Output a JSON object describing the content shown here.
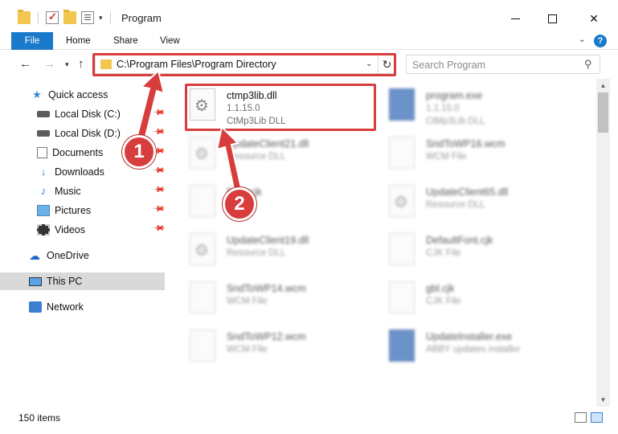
{
  "window": {
    "title": "Program",
    "controls": {
      "minimize": "minimize",
      "maximize": "maximize",
      "close": "✕"
    }
  },
  "ribbon": {
    "tabs": [
      "File",
      "Home",
      "Share",
      "View"
    ],
    "help": "?"
  },
  "address_bar": {
    "path": "C:\\Program Files\\Program Directory",
    "refresh_glyph": "↻"
  },
  "search": {
    "placeholder": "Search Program"
  },
  "sidebar": {
    "items": [
      {
        "label": "Quick access",
        "icon": "star-icon"
      },
      {
        "label": "Local Disk (C:)",
        "icon": "disk-icon",
        "pinned": true
      },
      {
        "label": "Local Disk (D:)",
        "icon": "disk-icon",
        "pinned": true
      },
      {
        "label": "Documents",
        "icon": "documents-icon",
        "pinned": true
      },
      {
        "label": "Downloads",
        "icon": "downloads-icon",
        "pinned": true
      },
      {
        "label": "Music",
        "icon": "music-icon",
        "pinned": true
      },
      {
        "label": "Pictures",
        "icon": "pictures-icon",
        "pinned": true
      },
      {
        "label": "Videos",
        "icon": "videos-icon",
        "pinned": true
      },
      {
        "label": "OneDrive",
        "icon": "onedrive-icon"
      },
      {
        "label": "This PC",
        "icon": "this-pc-icon",
        "selected": true
      },
      {
        "label": "Network",
        "icon": "network-icon"
      }
    ]
  },
  "files": [
    {
      "name": "ctmp3lib.dll",
      "line2": "1.1.15.0",
      "line3": "CtMp3Lib DLL",
      "icon": "dll-icon",
      "highlighted": true
    },
    {
      "name": "program.exe",
      "line2": "1.1.15.0",
      "line3": "CtMp3Lib DLL",
      "icon": "exe-icon",
      "blurred": true
    },
    {
      "name": "UpdateClient21.dll",
      "line2": "Resource DLL",
      "icon": "dll-icon",
      "blurred": true
    },
    {
      "name": "SndToWP16.wcm",
      "line2": "WCM File",
      "icon": "file-icon",
      "blurred": true
    },
    {
      "name": "Font.cjk",
      "line2": "",
      "icon": "file-icon",
      "blurred": true
    },
    {
      "name": "UpdateClient65.dll",
      "line2": "Resource DLL",
      "icon": "dll-icon",
      "blurred": true
    },
    {
      "name": "UpdateClient19.dll",
      "line2": "Resource DLL",
      "icon": "dll-icon",
      "blurred": true
    },
    {
      "name": "DefaultFont.cjk",
      "line2": "CJK File",
      "icon": "file-icon",
      "blurred": true
    },
    {
      "name": "SndToWP14.wcm",
      "line2": "WCM File",
      "icon": "file-icon",
      "blurred": true
    },
    {
      "name": "gbl.cjk",
      "line2": "CJK File",
      "icon": "file-icon",
      "blurred": true
    },
    {
      "name": "SndToWP12.wcm",
      "line2": "WCM File",
      "icon": "file-icon",
      "blurred": true
    },
    {
      "name": "UpdateInstaller.exe",
      "line2": "ABBY updates installer",
      "icon": "installer-icon",
      "blurred": true
    }
  ],
  "status": {
    "item_count": "150 items"
  },
  "callouts": [
    "1",
    "2"
  ],
  "colors": {
    "accent": "#1979ca",
    "highlight": "#d83d3d",
    "selected_nav": "#d9d9d9"
  }
}
